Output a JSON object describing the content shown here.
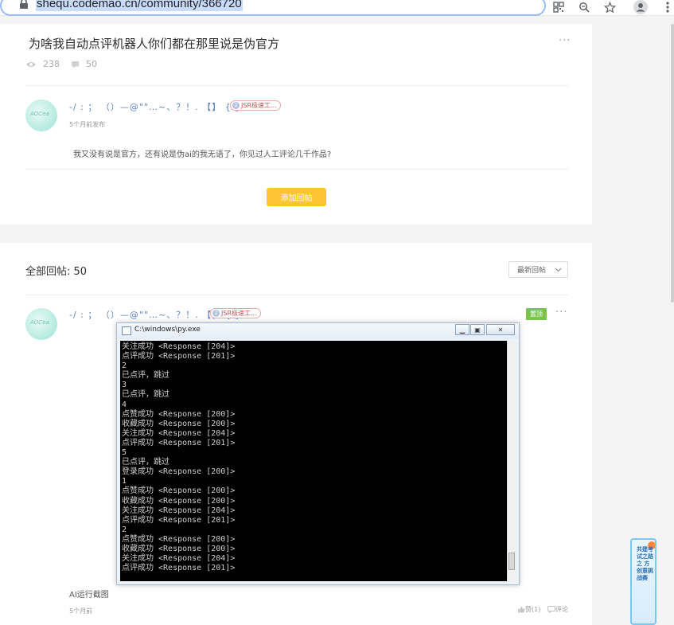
{
  "browser": {
    "url": "shequ.codemao.cn/community/366720",
    "icons": [
      "lock-icon",
      "qr-icon",
      "zoom-icon",
      "star-icon",
      "profile-icon",
      "kebab-menu-icon"
    ]
  },
  "post": {
    "title": "为啥我自动点评机器人你们都在那里说是伪官方",
    "views": "238",
    "replies": "50",
    "more": "···"
  },
  "first_reply": {
    "nickname": "-/ : ； （）—@\"\"…~、？！. 【】 { }",
    "badge": "JSR极速工...",
    "badge_level": "2",
    "avatar_text": "AOCea",
    "time": "5个月前发布",
    "text": "我又没有说是官方，还有说是伪ai的我无语了，你见过人工评论几千作品?"
  },
  "add_reply_button": "添加回帖",
  "replies_section": {
    "title": "全部回帖: 50",
    "sort": "最新回帖"
  },
  "pinned_reply": {
    "nickname": "-/ : ； （）—@\"\"…~、？！. 【】 { }",
    "badge": "JSR极速工...",
    "badge_level": "2",
    "avatar_text": "AOCea",
    "pin_label": "置顶",
    "more": "···",
    "caption": "AI运行截图",
    "time": "5个月前",
    "like_label": "赞(1)",
    "comment_label": "评论"
  },
  "console": {
    "title": "C:\\windows\\py.exe",
    "lines": [
      "关注成功 <Response [204]>",
      "点评成功 <Response [201]>",
      "2",
      "已点评，跳过",
      "3",
      "已点评，跳过",
      "4",
      "点赞成功 <Response [200]>",
      "收藏成功 <Response [200]>",
      "关注成功 <Response [204]>",
      "点评成功 <Response [201]>",
      "5",
      "已点评，跳过",
      "登录成功 <Response [200]>",
      "1",
      "点赞成功 <Response [200]>",
      "收藏成功 <Response [200]>",
      "关注成功 <Response [204]>",
      "点评成功 <Response [201]>",
      "2",
      "点赞成功 <Response [200]>",
      "收藏成功 <Response [200]>",
      "关注成功 <Response [204]>",
      "点评成功 <Response [201]>"
    ]
  },
  "side_banner": {
    "text": "共建考试之路之 方创意挑战赛"
  },
  "colors": {
    "accent_button": "#fec433",
    "pin_green": "#7bc44b",
    "nickname_blue": "#5a7fbf",
    "url_highlight": "#c8dcfa"
  }
}
